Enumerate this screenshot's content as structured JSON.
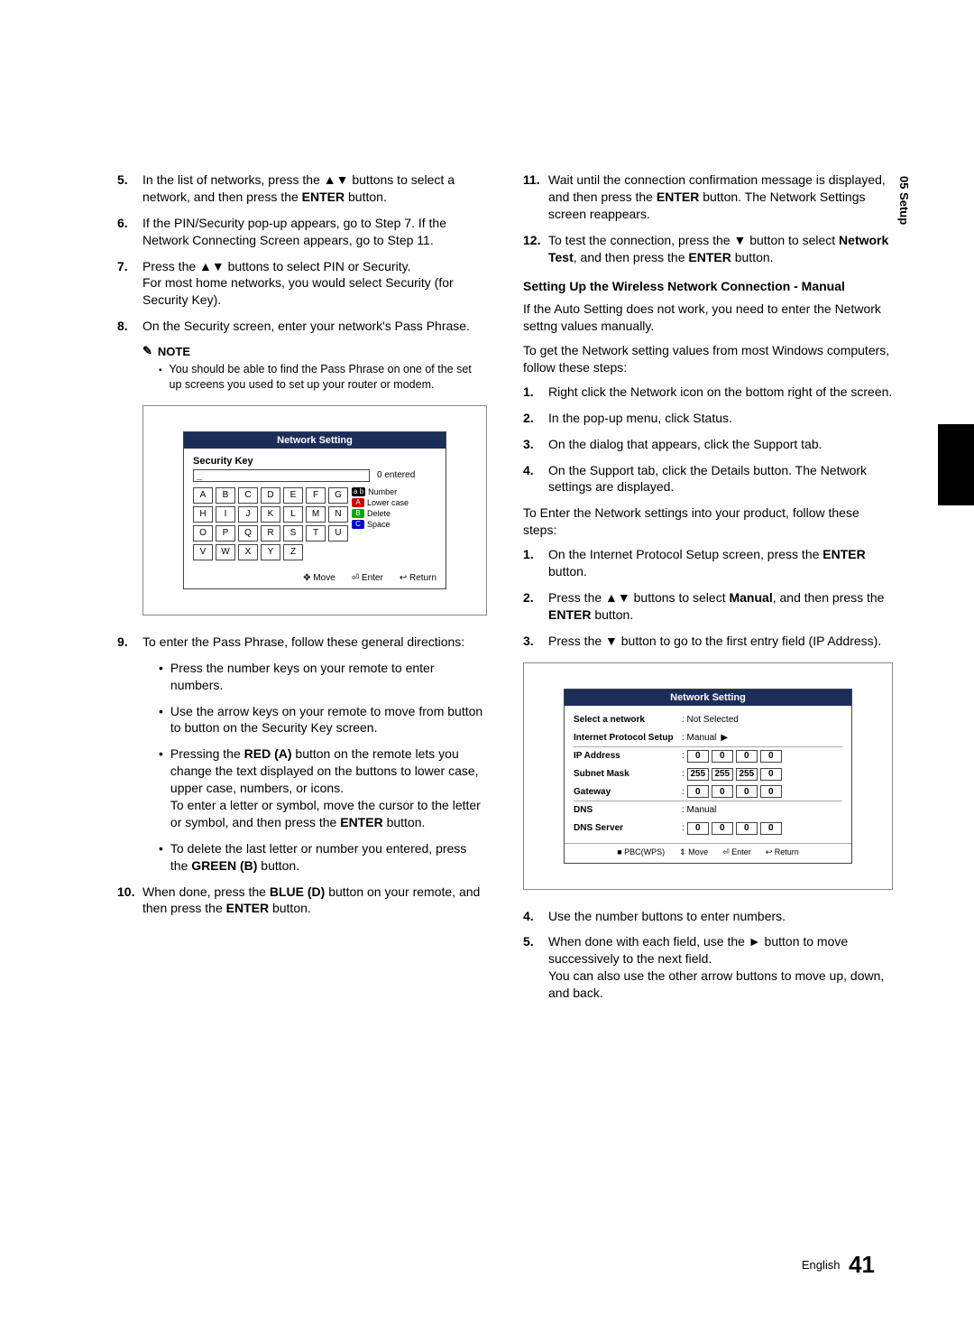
{
  "side_tab": "05   Setup",
  "left": {
    "steps_a": [
      {
        "n": "5.",
        "t": "In the list of networks, press the ▲▼ buttons to select a network, and then press the ENTER button."
      },
      {
        "n": "6.",
        "t": "If the PIN/Security pop-up appears, go to Step 7. If the Network Connecting Screen appears, go to Step 11."
      },
      {
        "n": "7.",
        "t": "Press the ▲▼ buttons to select PIN or Security.\nFor most home networks, you would select Security (for Security Key)."
      },
      {
        "n": "8.",
        "t": "On the Security screen, enter your network's Pass Phrase."
      }
    ],
    "note_label": "NOTE",
    "note_text": "You should be able to find the Pass Phrase on one of the set up screens you used to set up your router or modem.",
    "fig1": {
      "title": "Network Setting",
      "security_key": "Security Key",
      "entered": "0 entered",
      "rows": [
        [
          "A",
          "B",
          "C",
          "D",
          "E",
          "F",
          "G"
        ],
        [
          "H",
          "I",
          "J",
          "K",
          "L",
          "M",
          "N"
        ],
        [
          "O",
          "P",
          "Q",
          "R",
          "S",
          "T",
          "U"
        ],
        [
          "V",
          "W",
          "X",
          "Y",
          "Z"
        ]
      ],
      "legend": [
        {
          "cls": "",
          "label": "Number",
          "badge": "a b"
        },
        {
          "cls": "red",
          "label": "Lower case",
          "badge": "A"
        },
        {
          "cls": "green",
          "label": "Delete",
          "badge": "B"
        },
        {
          "cls": "blue",
          "label": "Space",
          "badge": "C"
        }
      ],
      "footer": [
        "✥ Move",
        "⏎ Enter",
        "↩ Return"
      ]
    },
    "steps_b": [
      {
        "n": "9.",
        "t": "To enter the Pass Phrase, follow these general directions:"
      }
    ],
    "bullets": [
      "Press the number keys on your remote to enter numbers.",
      "Use the arrow keys on your remote to move from button to button on the Security Key screen.",
      "Pressing the RED (A) button on the remote lets you change the text displayed on the buttons to lower case, upper case, numbers, or icons.\nTo enter a letter or symbol, move the cursor to the letter or symbol, and then press the ENTER button.",
      "To delete the last letter or number you entered, press the GREEN (B) button."
    ],
    "step10": {
      "n": "10.",
      "t": "When done, press the BLUE (D) button on your remote, and then press the ENTER button."
    }
  },
  "right": {
    "steps_c": [
      {
        "n": "11.",
        "t": "Wait until the connection confirmation message is displayed, and then press the ENTER button. The Network Settings screen reappears."
      },
      {
        "n": "12.",
        "t": "To test the connection, press the ▼ button to select Network Test, and then press the ENTER button."
      }
    ],
    "heading": "Setting Up the Wireless Network Connection - Manual",
    "para1": "If the Auto Setting does not work, you need to enter the Network settng values manually.",
    "para2": "To get the Network setting values from most Windows computers, follow these steps:",
    "steps_d": [
      {
        "n": "1.",
        "t": "Right click the Network icon on the bottom right of the screen."
      },
      {
        "n": "2.",
        "t": "In the pop-up menu, click Status."
      },
      {
        "n": "3.",
        "t": "On the dialog that appears, click the Support tab."
      },
      {
        "n": "4.",
        "t": "On the Support tab, click the Details button. The Network settings are displayed."
      }
    ],
    "para3": "To Enter the Network settings into your product, follow these steps:",
    "steps_e": [
      {
        "n": "1.",
        "t": "On the Internet Protocol Setup screen, press the ENTER button."
      },
      {
        "n": "2.",
        "t": "Press the ▲▼ buttons to select Manual, and then press the ENTER button."
      },
      {
        "n": "3.",
        "t": "Press the ▼ button to go to the first entry field (IP Address)."
      }
    ],
    "fig2": {
      "title": "Network Setting",
      "rows": [
        {
          "label": "Select a network",
          "val": ": Not Selected"
        },
        {
          "label": "Internet Protocol Setup",
          "val": ": Manual",
          "arrow": true
        },
        {
          "label": "IP Address",
          "ip": [
            "0",
            "0",
            "0",
            "0"
          ]
        },
        {
          "label": "Subnet Mask",
          "ip": [
            "255",
            "255",
            "255",
            "0"
          ]
        },
        {
          "label": "Gateway",
          "ip": [
            "0",
            "0",
            "0",
            "0"
          ]
        },
        {
          "label": "DNS",
          "val": ": Manual"
        },
        {
          "label": "DNS Server",
          "ip": [
            "0",
            "0",
            "0",
            "0"
          ]
        }
      ],
      "footer": [
        "■ PBC(WPS)",
        "⇕ Move",
        "⏎ Enter",
        "↩ Return"
      ]
    },
    "steps_f": [
      {
        "n": "4.",
        "t": "Use the number buttons to enter numbers."
      },
      {
        "n": "5.",
        "t": "When done with each field, use the ► button to move successively to the next field.\nYou can also use the other arrow buttons to move up, down, and back."
      }
    ]
  },
  "footer": {
    "lang": "English",
    "page": "41"
  }
}
